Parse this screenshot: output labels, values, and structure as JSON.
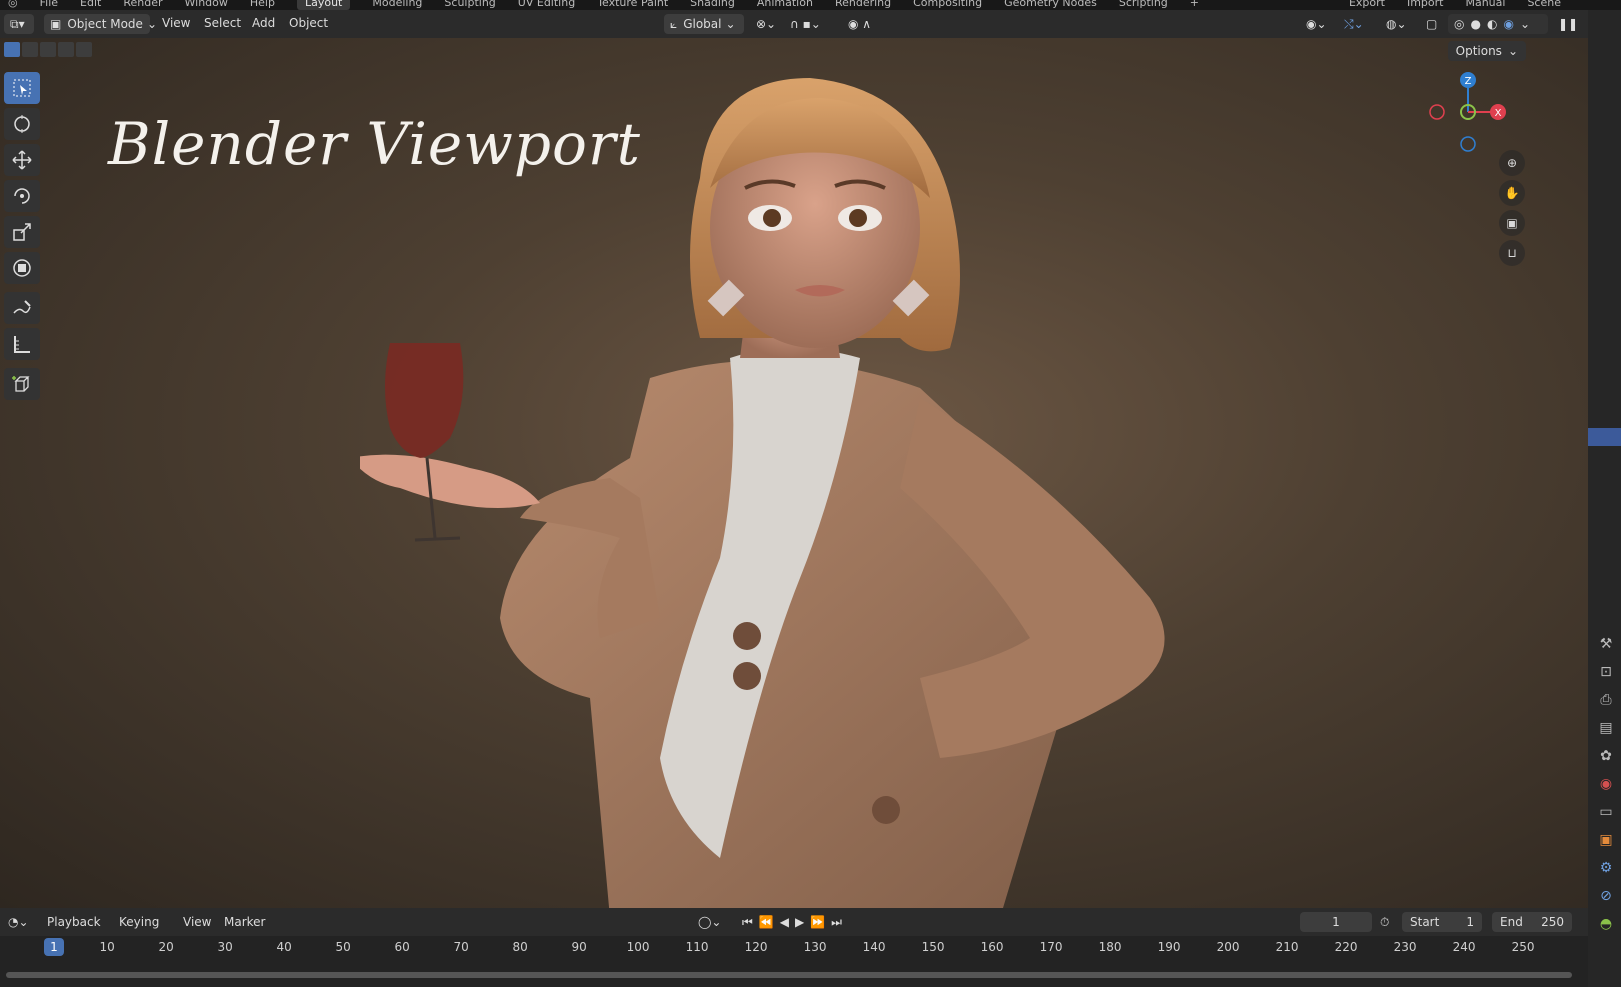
{
  "topbar": {
    "menus": [
      "File",
      "Edit",
      "Render",
      "Window",
      "Help"
    ],
    "workspaces": [
      "Layout",
      "Modeling",
      "Sculpting",
      "UV Editing",
      "Texture Paint",
      "Shading",
      "Animation",
      "Rendering",
      "Compositing",
      "Geometry Nodes",
      "Scripting",
      "+"
    ],
    "right": [
      "Export",
      "Import",
      "Manual",
      "Scene"
    ]
  },
  "header": {
    "mode": "Object Mode",
    "menus": [
      "View",
      "Select",
      "Add",
      "Object"
    ],
    "transform": "Global"
  },
  "viewport": {
    "title": "Blender Viewport",
    "options": "Options",
    "gizmo": {
      "z": "Z",
      "x": "X"
    }
  },
  "timeline": {
    "menus": [
      "Playback",
      "Keying",
      "View",
      "Marker"
    ],
    "current_frame": "1",
    "start_label": "Start",
    "start": "1",
    "end_label": "End",
    "end": "250",
    "ticks": [
      "1",
      "10",
      "20",
      "30",
      "40",
      "50",
      "60",
      "70",
      "80",
      "90",
      "100",
      "110",
      "120",
      "130",
      "140",
      "150",
      "160",
      "170",
      "180",
      "190",
      "200",
      "210",
      "220",
      "230",
      "240",
      "250"
    ]
  },
  "colors": {
    "accent": "#4772b3",
    "x_axis": "#e0404f",
    "y_axis": "#8bc34a",
    "z_axis": "#2f7fd1"
  }
}
